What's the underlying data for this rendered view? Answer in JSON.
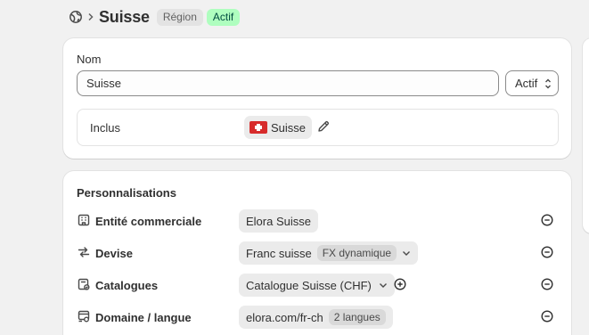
{
  "header": {
    "title": "Suisse",
    "type_badge": "Région",
    "status_badge": "Actif"
  },
  "general": {
    "name_label": "Nom",
    "name_value": "Suisse",
    "status_value": "Actif",
    "included_label": "Inclus",
    "included_country": "Suisse"
  },
  "customizations": {
    "title": "Personnalisations",
    "rows": [
      {
        "label": "Entité commerciale",
        "value": "Elora Suisse",
        "icon": "building-icon"
      },
      {
        "label": "Devise",
        "value": "Franc suisse",
        "tag": "FX dynamique",
        "icon": "currency-exchange-icon"
      },
      {
        "label": "Catalogues",
        "value": "Catalogue Suisse (CHF)",
        "icon": "catalog-icon"
      },
      {
        "label": "Domaine / langue",
        "value": "elora.com/fr-ch",
        "tag": "2 langues",
        "icon": "domain-icon"
      }
    ]
  },
  "colors": {
    "active_badge_bg": "#affebf",
    "active_badge_text": "#014b40",
    "flag_red": "#d72b2b"
  }
}
